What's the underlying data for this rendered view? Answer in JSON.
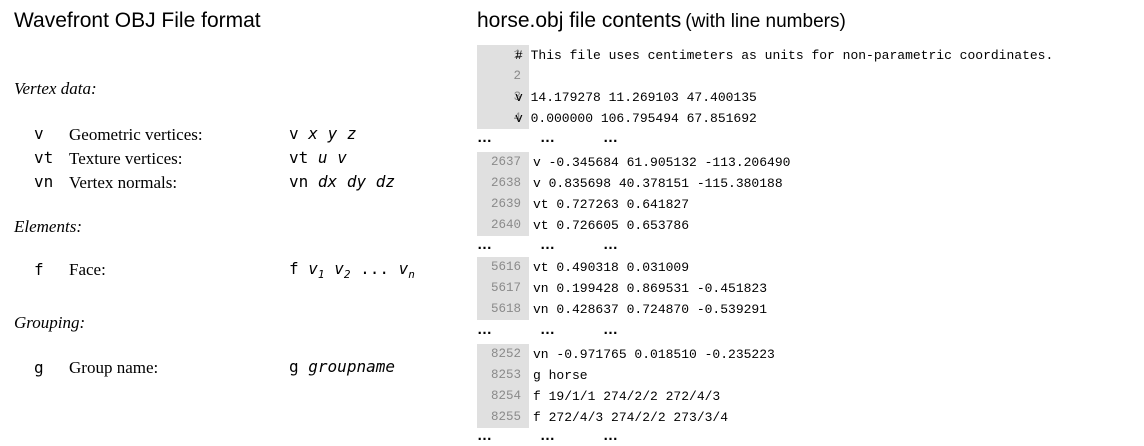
{
  "left_title": "Wavefront OBJ File format",
  "right_title": "horse.obj file contents",
  "right_title_sub": "(with line numbers)",
  "sections": {
    "vertex": {
      "heading": "Vertex data:",
      "rows": [
        {
          "kw": "v",
          "desc": "Geometric vertices:",
          "syntax_kw": "v",
          "syntax_args": [
            "x",
            "y",
            "z"
          ]
        },
        {
          "kw": "vt",
          "desc": "Texture vertices:",
          "syntax_kw": "vt",
          "syntax_args": [
            "u",
            "v"
          ]
        },
        {
          "kw": "vn",
          "desc": "Vertex normals:",
          "syntax_kw": "vn",
          "syntax_args": [
            "dx",
            "dy",
            "dz"
          ]
        }
      ]
    },
    "elements": {
      "heading": "Elements:",
      "row": {
        "kw": "f",
        "desc": "Face:",
        "syntax_kw": "f",
        "v1": "v",
        "v1_sub": "1",
        "v2": "v",
        "v2_sub": "2",
        "dots": "...",
        "vn": "v",
        "vn_sub": "n"
      }
    },
    "grouping": {
      "heading": "Grouping:",
      "row": {
        "kw": "g",
        "desc": "Group name:",
        "syntax_kw": "g",
        "syntax_arg": "groupname"
      }
    }
  },
  "ellipsis": "…",
  "code_blocks": [
    {
      "lines": [
        {
          "n": "1",
          "text": "# This file uses centimeters as units for non-parametric coordinates."
        },
        {
          "n": "2",
          "text": ""
        },
        {
          "n": "3",
          "text": "v 14.179278 11.269103 47.400135"
        },
        {
          "n": "4",
          "text": "v 0.000000 106.795494 67.851692"
        }
      ]
    },
    {
      "lines": [
        {
          "n": "2637",
          "text": "v -0.345684 61.905132 -113.206490"
        },
        {
          "n": "2638",
          "text": "v 0.835698 40.378151 -115.380188"
        },
        {
          "n": "2639",
          "text": "vt 0.727263 0.641827"
        },
        {
          "n": "2640",
          "text": "vt 0.726605 0.653786"
        }
      ]
    },
    {
      "lines": [
        {
          "n": "5616",
          "text": "vt 0.490318 0.031009"
        },
        {
          "n": "5617",
          "text": "vn 0.199428 0.869531 -0.451823"
        },
        {
          "n": "5618",
          "text": "vn 0.428637 0.724870 -0.539291"
        }
      ]
    },
    {
      "lines": [
        {
          "n": "8252",
          "text": "vn -0.971765 0.018510 -0.235223"
        },
        {
          "n": "8253",
          "text": "g horse"
        },
        {
          "n": "8254",
          "text": "f 19/1/1 274/2/2 272/4/3"
        },
        {
          "n": "8255",
          "text": "f 272/4/3 274/2/2 273/3/4"
        }
      ]
    }
  ]
}
